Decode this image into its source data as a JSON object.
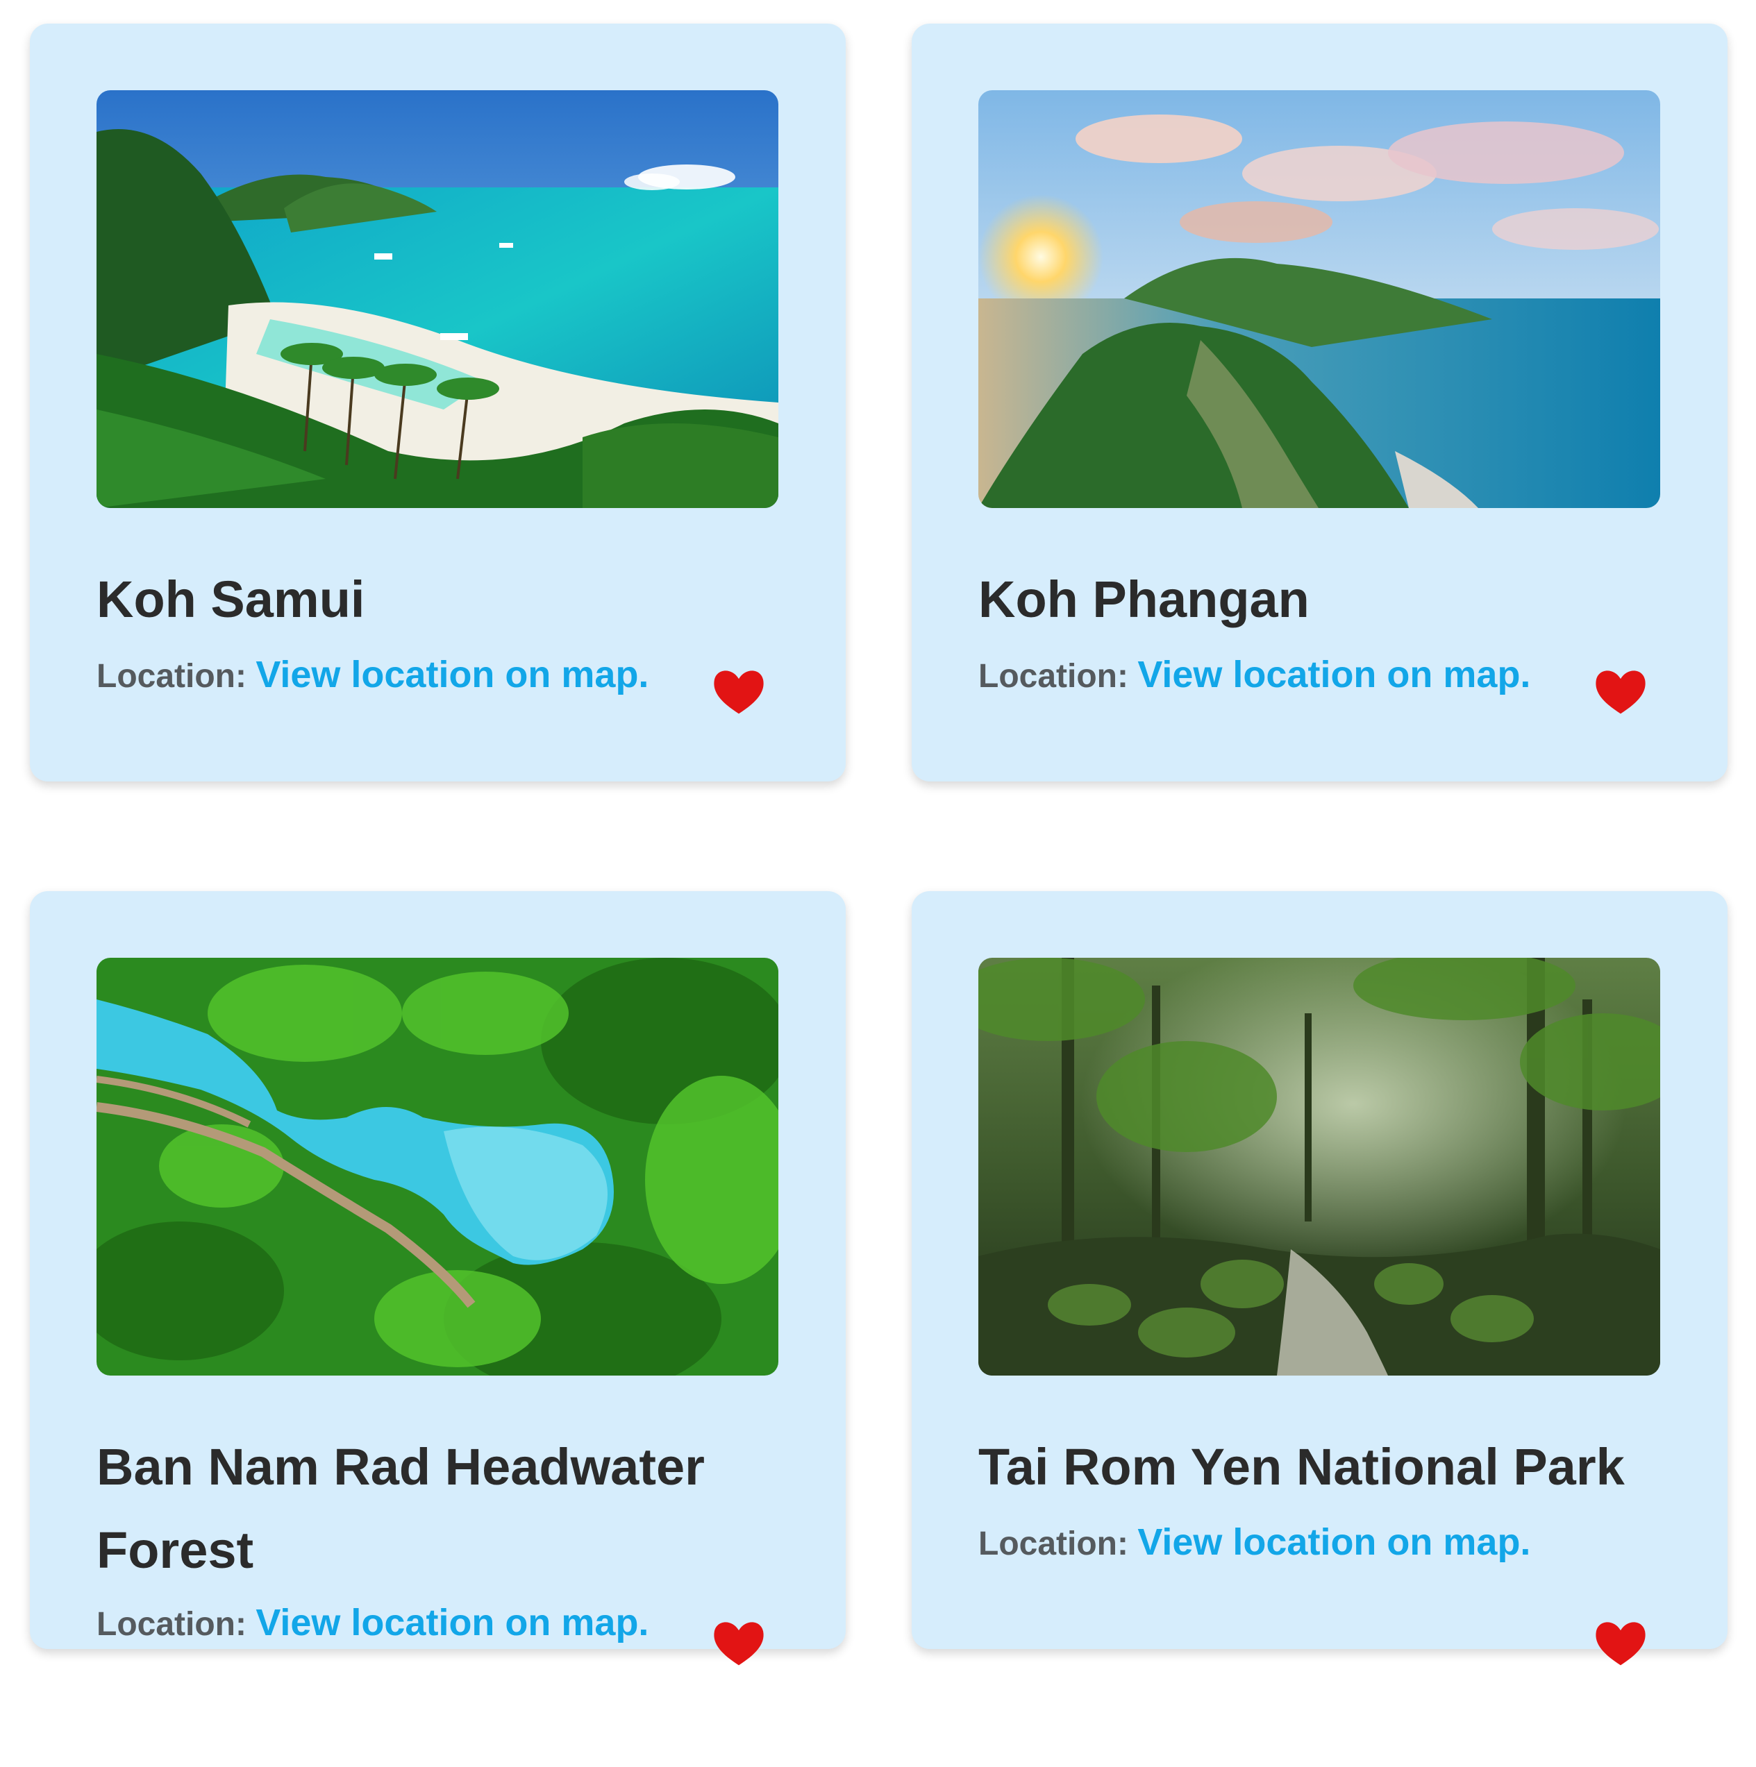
{
  "colors": {
    "card_background": "#d6edfc",
    "title_text": "#2b2b2b",
    "location_label": "#555a5e",
    "link": "#12a6e8",
    "heart": "#e21414"
  },
  "cards": [
    {
      "title": "Koh Samui",
      "location_label": "Location:",
      "location_link": "View location on map.",
      "favorite_icon": "heart-icon",
      "photo": "tropical-beach-bay-photo"
    },
    {
      "title": "Koh Phangan",
      "location_label": "Location:",
      "location_link": "View location on map.",
      "favorite_icon": "heart-icon",
      "photo": "island-peninsula-sunset-photo"
    },
    {
      "title": "Ban Nam Rad Headwater Forest",
      "location_label": "Location:",
      "location_link": "View location on map.",
      "favorite_icon": "heart-icon",
      "photo": "turquoise-pool-aerial-photo"
    },
    {
      "title": "Tai Rom Yen National Park",
      "location_label": "Location:",
      "location_link": "View location on map.",
      "favorite_icon": "heart-icon",
      "photo": "rainforest-stream-photo"
    }
  ]
}
